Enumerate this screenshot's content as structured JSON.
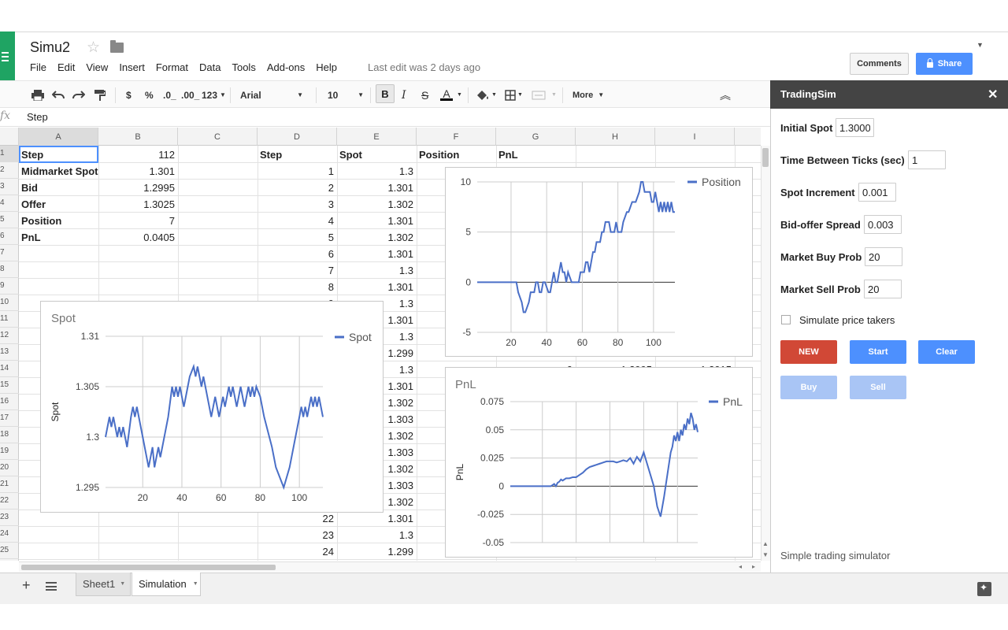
{
  "doc": {
    "title": "Simu2",
    "last_edit": "Last edit was 2 days ago"
  },
  "menu": [
    "File",
    "Edit",
    "View",
    "Insert",
    "Format",
    "Data",
    "Tools",
    "Add-ons",
    "Help"
  ],
  "header": {
    "comments": "Comments",
    "share": "Share"
  },
  "toolbar": {
    "currency": "$",
    "percent": "%",
    "dec_less": ".0_",
    "dec_more": ".00_",
    "more_formats": "123",
    "font": "Arial",
    "font_size": "10",
    "bold": "B",
    "italic": "I",
    "strike": "S",
    "text_color": "A",
    "more": "More"
  },
  "formula": {
    "fx": "fx",
    "value": "Step"
  },
  "columns": [
    "A",
    "B",
    "C",
    "D",
    "E",
    "F",
    "G",
    "H",
    "I"
  ],
  "rows": [
    "1",
    "2",
    "3",
    "4",
    "5",
    "6",
    "7",
    "8",
    "9",
    "10",
    "11",
    "12",
    "13",
    "14",
    "15",
    "16",
    "17",
    "18",
    "19",
    "20",
    "21",
    "22",
    "23",
    "24",
    "25"
  ],
  "params": [
    {
      "label": "Step",
      "value": "112"
    },
    {
      "label": "Midmarket Spot",
      "value": "1.301"
    },
    {
      "label": "Bid",
      "value": "1.2995"
    },
    {
      "label": "Offer",
      "value": "1.3025"
    },
    {
      "label": "Position",
      "value": "7"
    },
    {
      "label": "PnL",
      "value": "0.0405"
    }
  ],
  "table_headers": [
    "Step",
    "Spot",
    "Position",
    "PnL"
  ],
  "table_rows": [
    {
      "step": "1",
      "spot": "1.3"
    },
    {
      "step": "2",
      "spot": "1.301"
    },
    {
      "step": "3",
      "spot": "1.302"
    },
    {
      "step": "4",
      "spot": "1.301"
    },
    {
      "step": "5",
      "spot": "1.302"
    },
    {
      "step": "6",
      "spot": "1.301"
    },
    {
      "step": "7",
      "spot": "1.3"
    },
    {
      "step": "8",
      "spot": "1.301"
    },
    {
      "step": "9",
      "spot": "1.3"
    },
    {
      "step": "10",
      "spot": "1.301"
    },
    {
      "step": "11",
      "spot": "1.3"
    },
    {
      "step": "12",
      "spot": "1.299"
    },
    {
      "step": "13",
      "spot": "1.3"
    },
    {
      "step": "14",
      "spot": "1.301"
    },
    {
      "step": "15",
      "spot": "1.302"
    },
    {
      "step": "16",
      "spot": "1.303"
    },
    {
      "step": "17",
      "spot": "1.302"
    },
    {
      "step": "18",
      "spot": "1.303"
    },
    {
      "step": "19",
      "spot": "1.302"
    },
    {
      "step": "20",
      "spot": "1.303"
    },
    {
      "step": "21",
      "spot": "1.302"
    },
    {
      "step": "22",
      "spot": "1.301"
    },
    {
      "step": "23",
      "spot": "1.3"
    },
    {
      "step": "24",
      "spot": "1.299"
    }
  ],
  "partial_row_14": {
    "f": "0",
    "g": "0",
    "h": "1.2995",
    "i": "1.3015"
  },
  "tabs": [
    "Sheet1",
    "Simulation"
  ],
  "sidebar": {
    "title": "TradingSim",
    "fields": [
      {
        "label": "Initial Spot",
        "value": "1.3000"
      },
      {
        "label": "Time Between Ticks (sec)",
        "value": "1"
      },
      {
        "label": "Spot Increment",
        "value": "0.001"
      },
      {
        "label": "Bid-offer Spread",
        "value": "0.003"
      },
      {
        "label": "Market Buy Prob",
        "value": "20"
      },
      {
        "label": "Market Sell Prob",
        "value": "20"
      }
    ],
    "checkbox_label": "Simulate price takers",
    "buttons": {
      "new": "NEW",
      "start": "Start",
      "clear": "Clear",
      "buy": "Buy",
      "sell": "Sell"
    },
    "footer": "Simple trading simulator"
  },
  "colors": {
    "line": "#4a6fc7",
    "new": "#d14836",
    "blue": "#4d90fe",
    "disabled": "#a9c5f5"
  },
  "chart_data": [
    {
      "type": "line",
      "title": "Spot",
      "ylabel": "Spot",
      "xlim": [
        1,
        112
      ],
      "ylim": [
        1.295,
        1.31
      ],
      "xticks": [
        "20",
        "40",
        "60",
        "80",
        "100"
      ],
      "yticks": [
        "1.31",
        "1.305",
        "1.3",
        "1.295"
      ],
      "legend": "top-right",
      "series": [
        {
          "name": "Spot",
          "x": [
            1,
            3,
            4,
            5,
            6,
            7,
            8,
            9,
            10,
            11,
            12,
            14,
            15,
            16,
            17,
            18,
            20,
            23,
            24,
            25,
            26,
            27,
            28,
            29,
            30,
            33,
            35,
            36,
            37,
            38,
            39,
            40,
            41,
            42,
            43,
            44,
            46,
            47,
            48,
            49,
            50,
            51,
            52,
            53,
            54,
            55,
            56,
            57,
            58,
            59,
            60,
            61,
            62,
            63,
            64,
            65,
            66,
            67,
            68,
            69,
            70,
            71,
            72,
            73,
            74,
            75,
            76,
            77,
            78,
            80,
            82,
            86,
            88,
            92,
            95,
            97,
            100,
            101,
            102,
            103,
            104,
            105,
            106,
            107,
            108,
            109,
            110,
            112
          ],
          "values": [
            1.3,
            1.302,
            1.301,
            1.302,
            1.301,
            1.3,
            1.301,
            1.3,
            1.301,
            1.3,
            1.299,
            1.302,
            1.303,
            1.302,
            1.303,
            1.302,
            1.3,
            1.297,
            1.298,
            1.299,
            1.297,
            1.298,
            1.299,
            1.298,
            1.299,
            1.302,
            1.305,
            1.304,
            1.305,
            1.304,
            1.305,
            1.304,
            1.303,
            1.304,
            1.305,
            1.306,
            1.307,
            1.306,
            1.307,
            1.306,
            1.305,
            1.306,
            1.305,
            1.304,
            1.303,
            1.302,
            1.303,
            1.304,
            1.303,
            1.302,
            1.303,
            1.304,
            1.303,
            1.304,
            1.305,
            1.304,
            1.305,
            1.304,
            1.303,
            1.304,
            1.305,
            1.304,
            1.303,
            1.304,
            1.305,
            1.304,
            1.305,
            1.304,
            1.305,
            1.304,
            1.302,
            1.299,
            1.297,
            1.295,
            1.297,
            1.299,
            1.302,
            1.303,
            1.302,
            1.303,
            1.302,
            1.303,
            1.304,
            1.303,
            1.304,
            1.303,
            1.304,
            1.302
          ]
        }
      ]
    },
    {
      "type": "line",
      "title": "",
      "xlim": [
        1,
        112
      ],
      "ylim": [
        -5,
        10
      ],
      "xticks": [
        "20",
        "40",
        "60",
        "80",
        "100"
      ],
      "yticks": [
        "10",
        "5",
        "0",
        "-5"
      ],
      "legend": "top-right",
      "series": [
        {
          "name": "Position",
          "x": [
            1,
            23,
            24,
            26,
            27,
            28,
            30,
            31,
            33,
            34,
            35,
            36,
            37,
            38,
            39,
            41,
            42,
            43,
            44,
            45,
            46,
            47,
            48,
            49,
            50,
            51,
            52,
            54,
            56,
            58,
            59,
            61,
            62,
            63,
            64,
            65,
            66,
            67,
            68,
            70,
            71,
            72,
            73,
            75,
            76,
            78,
            79,
            80,
            82,
            83,
            85,
            86,
            88,
            90,
            92,
            93,
            94,
            95,
            96,
            97,
            98,
            99,
            100,
            101,
            102,
            103,
            104,
            105,
            106,
            107,
            108,
            109,
            110,
            111,
            112
          ],
          "values": [
            0,
            0,
            -1,
            -2,
            -3,
            -3,
            -2,
            -1,
            -1,
            0,
            0,
            -1,
            -1,
            0,
            0,
            -1,
            -1,
            0,
            1,
            0,
            0,
            1,
            2,
            1,
            1,
            0,
            1,
            0,
            0,
            0,
            1,
            1,
            2,
            2,
            1,
            2,
            3,
            3,
            4,
            4,
            5,
            5,
            6,
            6,
            5,
            5,
            6,
            5,
            5,
            6,
            7,
            7,
            8,
            8,
            9,
            10,
            10,
            9,
            9,
            9,
            9,
            8,
            8,
            9,
            8,
            7,
            8,
            7,
            8,
            7,
            8,
            7,
            8,
            7,
            7
          ]
        }
      ]
    },
    {
      "type": "line",
      "title": "PnL",
      "ylabel": "PnL",
      "xlim": [
        1,
        112
      ],
      "ylim": [
        -0.05,
        0.075
      ],
      "yticks": [
        "0.075",
        "0.05",
        "0.025",
        "0",
        "-0.025",
        "-0.05"
      ],
      "legend": "top-right",
      "series": [
        {
          "name": "PnL",
          "x": [
            1,
            23,
            25,
            27,
            28,
            29,
            30,
            31,
            32,
            34,
            36,
            38,
            40,
            42,
            44,
            46,
            48,
            50,
            52,
            54,
            56,
            58,
            60,
            62,
            64,
            66,
            68,
            70,
            72,
            74,
            76,
            78,
            80,
            82,
            84,
            86,
            88,
            90,
            92,
            94,
            95,
            96,
            97,
            98,
            99,
            100,
            101,
            102,
            103,
            104,
            105,
            106,
            107,
            108,
            109,
            110,
            111,
            112
          ],
          "values": [
            0,
            0,
            0,
            0.002,
            0,
            0.003,
            0.004,
            0.006,
            0.005,
            0.007,
            0.007,
            0.008,
            0.008,
            0.01,
            0.012,
            0.015,
            0.017,
            0.018,
            0.019,
            0.02,
            0.021,
            0.022,
            0.022,
            0.022,
            0.021,
            0.022,
            0.023,
            0.022,
            0.025,
            0.02,
            0.026,
            0.022,
            0.03,
            0.02,
            0.01,
            0,
            -0.018,
            -0.027,
            -0.01,
            0.01,
            0.02,
            0.03,
            0.035,
            0.045,
            0.04,
            0.048,
            0.04,
            0.05,
            0.045,
            0.055,
            0.05,
            0.06,
            0.055,
            0.065,
            0.06,
            0.05,
            0.055,
            0.048
          ]
        }
      ]
    }
  ]
}
